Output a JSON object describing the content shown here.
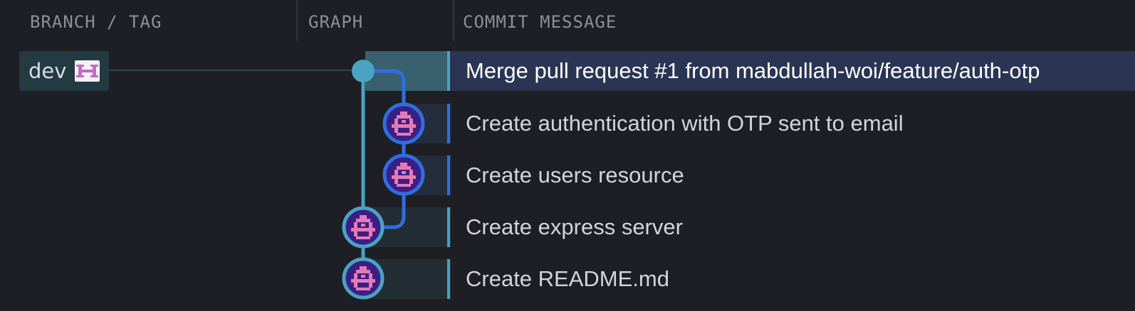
{
  "headers": {
    "branch_tag": "BRANCH / TAG",
    "graph": "GRAPH",
    "commit_message": "COMMIT MESSAGE"
  },
  "branch": {
    "name": "dev",
    "badge_icon": "pixel-avatar-icon"
  },
  "commits": [
    {
      "message": "Merge pull request #1 from mabdullah-woi/feature/auth-otp",
      "lane": 0,
      "selected": true,
      "icon": "merge-node-dot"
    },
    {
      "message": "Create authentication with OTP sent to email",
      "lane": 1,
      "selected": false,
      "icon": "pixel-avatar-icon"
    },
    {
      "message": "Create users resource",
      "lane": 1,
      "selected": false,
      "icon": "pixel-avatar-icon"
    },
    {
      "message": "Create express server",
      "lane": 0,
      "selected": false,
      "icon": "pixel-avatar-icon"
    },
    {
      "message": "Create README.md",
      "lane": 0,
      "selected": false,
      "icon": "pixel-avatar-icon"
    }
  ],
  "colors": {
    "background": "#1d1f24",
    "lane_main": "#4aa3c2",
    "lane_feature": "#2f6fe0",
    "selected_row": "#2a3553",
    "branch_pill": "#233a42",
    "avatar_bg": "#3b1f86",
    "avatar_pixels": "#e67ab3"
  }
}
